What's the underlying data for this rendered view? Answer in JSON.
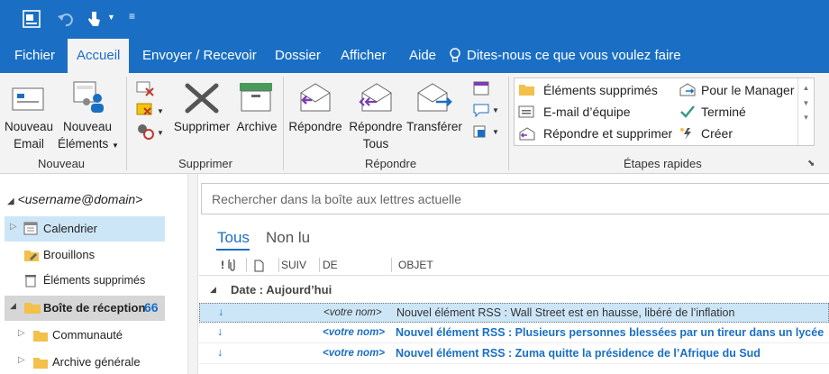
{
  "tabs": [
    "Fichier",
    "Accueil",
    "Envoyer / Recevoir",
    "Dossier",
    "Afficher",
    "Aide"
  ],
  "tell_me": "Dites-nous ce que vous voulez faire",
  "ribbon": {
    "new_mail": [
      "Nouveau",
      "Email"
    ],
    "new_items": [
      "Nouveau",
      "Éléments"
    ],
    "group_new": "Nouveau",
    "delete": "Supprimer",
    "archive": "Archive",
    "group_delete": "Supprimer",
    "reply": "Répondre",
    "reply_all": [
      "Répondre",
      "Tous"
    ],
    "forward": "Transférer",
    "group_respond": "Répondre",
    "group_quick": "Étapes rapides",
    "quick_steps": [
      "Éléments supprimés",
      "E-mail d’équipe",
      "Répondre et supprimer",
      "Pour le Manager",
      "Terminé",
      "Créer"
    ]
  },
  "nav": {
    "account": "<username@domain>",
    "items": [
      "Calendrier",
      "Brouillons",
      "Éléments supprimés",
      "Boîte de réception",
      "Communauté",
      "Archive générale"
    ],
    "inbox_count": "66"
  },
  "search_placeholder": "Rechercher dans la boîte aux lettres actuelle",
  "filters": [
    "Tous",
    "Non lu"
  ],
  "columns": [
    "SUIV",
    "DE",
    "OBJET"
  ],
  "group_header": "Date : Aujourd’hui",
  "messages": [
    {
      "from": "<votre nom>",
      "subject": "Nouvel élément RSS : Wall Street est en hausse, libéré de l’inflation",
      "unread": false
    },
    {
      "from": "<votre nom>",
      "subject": "Nouvel élément RSS : Plusieurs personnes blessées par un tireur dans un lycée",
      "unread": true
    },
    {
      "from": "<votre nom>",
      "subject": "Nouvel élément RSS : Zuma quitte la présidence de l’Afrique du Sud",
      "unread": true
    }
  ],
  "colors": {
    "accent": "#1a6fc4",
    "selected": "#cde6f7"
  }
}
